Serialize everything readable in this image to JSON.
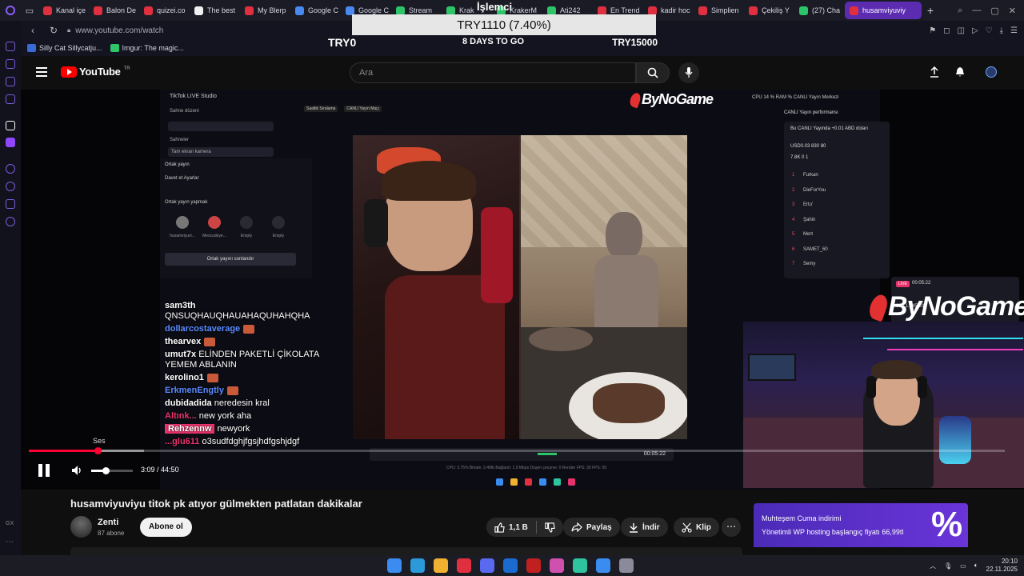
{
  "browser": {
    "tabs": [
      {
        "label": "Kanal içe",
        "color": "#e03040"
      },
      {
        "label": "Balon De",
        "color": "#e03040"
      },
      {
        "label": "quizei.co",
        "color": "#e03040"
      },
      {
        "label": "The best",
        "color": "#f0f0f0"
      },
      {
        "label": "My Blerp",
        "color": "#e03040"
      },
      {
        "label": "Google C",
        "color": "#4a8af0"
      },
      {
        "label": "Google C",
        "color": "#4a8af0"
      },
      {
        "label": "Stream",
        "color": "#2ec46a"
      },
      {
        "label": "Krak",
        "color": "#2ec46a"
      },
      {
        "label": "KrakerM",
        "color": "#2ec46a"
      },
      {
        "label": "Ati242",
        "color": "#2ec46a"
      },
      {
        "label": "En Trend",
        "color": "#e03040"
      },
      {
        "label": "kadir hoc",
        "color": "#e03040"
      },
      {
        "label": "Simplien",
        "color": "#e03040"
      },
      {
        "label": "Çekiliş Y",
        "color": "#e03040"
      },
      {
        "label": "(27) Cha",
        "color": "#2ec46a"
      },
      {
        "label": "husamviyuviy",
        "color": "#e03040",
        "active": true
      }
    ],
    "url": "www.youtube.com/watch",
    "bookmarks": [
      {
        "label": "Silly Cat Sillycatju...",
        "color": "#3a6ad8"
      },
      {
        "label": "Imgur: The magic...",
        "color": "#2ec46a"
      }
    ]
  },
  "donation": {
    "heading": "İşlemci",
    "bar_text": "TRY1110 (7.40%)",
    "min_label": "TRY0",
    "days_label": "8 DAYS TO GO",
    "max_label": "TRY15000",
    "progress": 7.4
  },
  "youtube": {
    "logo_text": "YouTube",
    "logo_region": "TR",
    "search_placeholder": "Ara"
  },
  "video_content": {
    "studio": {
      "title": "TikTok LIVE Studio",
      "scene_label": "Sahne düzeni",
      "scenes_label": "Sahneler",
      "screen_label": "Tam ekran kamera",
      "cohost_title": "Ortak yayın",
      "cohost_tabs": "Davet et     Ayarlar",
      "cohost_sub": "Ortak yayın yapmak",
      "cohost_names": [
        "husamviyuvi...",
        "Mescudeye...",
        "Empty",
        "Empty"
      ],
      "cohost_button": "Ortak yayını sonlandır",
      "top_tags": [
        "Saatlik Sıralama",
        "CANLI Yayın Maçı"
      ],
      "perf_top": "CPU 14 %   RAM %   CANLI Yayın Merkezi",
      "perf_title": "CANLI Yayın performansı",
      "perf_earn": "Bu CANLI Yayında +0.01 ABD doları",
      "perf_stats": "USD0.03   830   80",
      "perf_likes": "7.8K   0   1",
      "ranking": [
        "Furkan",
        "DieForYou",
        "Ertu'",
        "Şahin",
        "Mert",
        "SAMET_60",
        "Semy"
      ],
      "live_time": "00:05:22",
      "live_viewers": "830   1.545   80",
      "feed_time": "00:05:22",
      "stats_line": "CPU: 3.75%   Bitrate: 2.4Mb   Bağlantı: 1.9 Mbps   Düşen çerçeve: 0   Render FPS: 30   FPS: 30"
    },
    "chat": [
      {
        "user": "sam3th",
        "msg": "QNSUQHAUQHAUAHAQUHAHQHA",
        "user_color": "#ffffff",
        "block": true
      },
      {
        "user": "dollarcostaverage",
        "msg": "",
        "user_color": "#5a8cff",
        "emote": true
      },
      {
        "user": "thearvex",
        "msg": "",
        "user_color": "#ffffff",
        "emote": true
      },
      {
        "user": "umut7x",
        "msg": "ELİNDEN PAKETLİ ÇİKOLATA YEMEM ABLANIN",
        "user_color": "#ffffff"
      },
      {
        "user": "kerolino1",
        "msg": "",
        "user_color": "#ffffff",
        "emote": true
      },
      {
        "user": "ErkmenEngtly",
        "msg": "",
        "user_color": "#5a8cff",
        "emote": true
      },
      {
        "user": "dubidadida",
        "msg": "neredesin kral",
        "user_color": "#ffffff"
      },
      {
        "user": "Altınk...",
        "msg": "new york aha",
        "user_color": "#e7336b"
      },
      {
        "user": "Rehzennw",
        "msg": "newyork",
        "user_color": "#ffffff",
        "pill": true
      },
      {
        "user": "...glu611",
        "msg": "o3sudfdghjfgsjhdfgshjdgf",
        "user_color": "#e7336b"
      }
    ],
    "watermark": "ByNoGame"
  },
  "player": {
    "volume_tooltip": "Ses",
    "time_current": "3:09",
    "time_total": "44:50",
    "time_separator": " / ",
    "progress_played": 0.0703,
    "progress_buffered": 0.118,
    "volume_level": 0.35
  },
  "video": {
    "title": "husamviyuviyu titok pk atıyor gülmekten patlatan dakikalar",
    "channel": "Zenti",
    "subscribers": "87 abone",
    "subscribe": "Abone ol",
    "likes": "1,1 B",
    "share": "Paylaş",
    "download": "İndir",
    "clip": "Klip",
    "more": "⋯"
  },
  "ad": {
    "line1": "Muhteşem Cuma indirimi",
    "line2": "Yönetimli WP hosting başlangıç fiyatı 66,99tl",
    "symbol": "%"
  },
  "taskbar": {
    "time": "20:10",
    "date": "22.11.2025",
    "icon_colors": [
      "#3a8cf0",
      "#2a9ad8",
      "#f0b030",
      "#e03040",
      "#5a6af0",
      "#1a6ad0",
      "#c02020",
      "#d050b0",
      "#2ec4a0",
      "#3a8cf0",
      "#8a8a9a"
    ]
  }
}
